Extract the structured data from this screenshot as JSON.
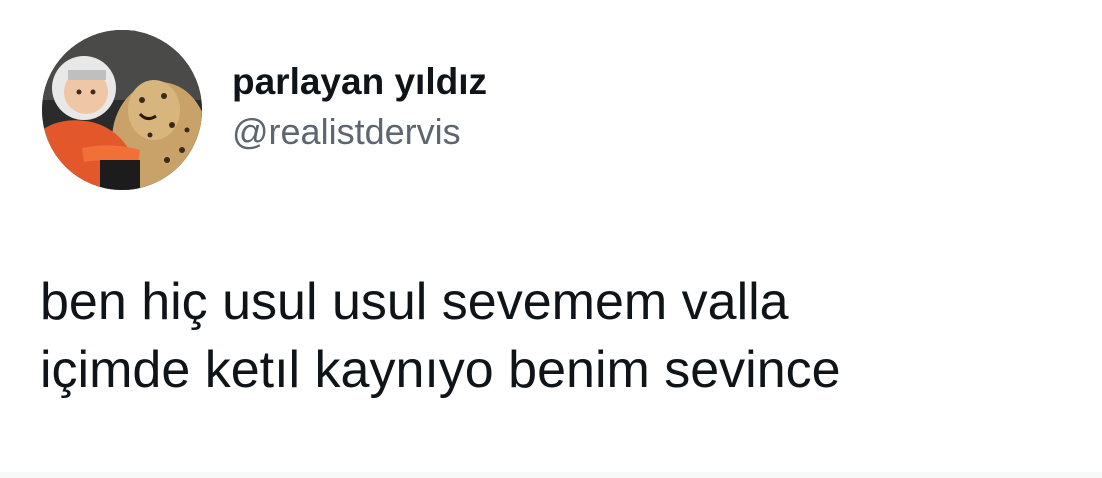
{
  "user": {
    "display_name": "parlayan yıldız",
    "handle": "@realistdervis"
  },
  "tweet": {
    "lines": [
      "ben hiç usul usul sevemem valla",
      "içimde ketıl kaynıyo benim sevince"
    ]
  }
}
